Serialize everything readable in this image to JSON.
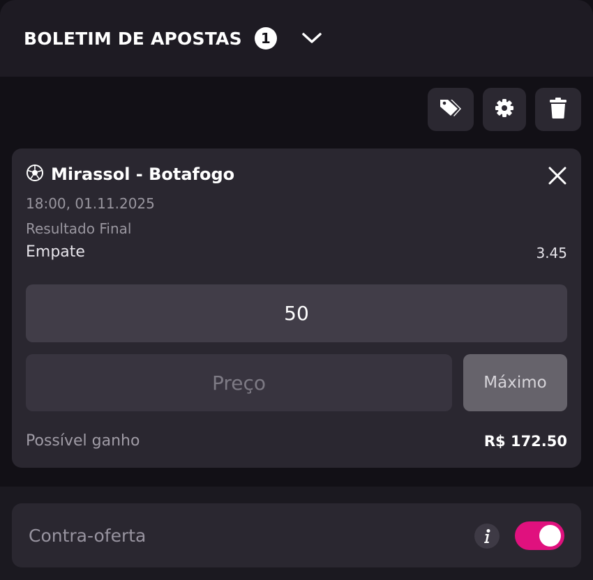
{
  "header": {
    "title": "BOLETIM DE APOSTAS",
    "count": "1",
    "chevron_icon": "chevron-down-icon"
  },
  "toolbar": {
    "tags_icon": "tags-icon",
    "settings_icon": "gear-icon",
    "trash_icon": "trash-icon"
  },
  "bet": {
    "sport_icon": "soccer-ball-icon",
    "match": "Mirassol - Botafogo",
    "datetime": "18:00, 01.11.2025",
    "market": "Resultado Final",
    "selection": "Empate",
    "odds": "3.45",
    "stake": "50",
    "price_placeholder": "Preço",
    "max_label": "Máximo",
    "gain_label": "Possível ganho",
    "gain_value": "R$ 172.50"
  },
  "counter_offer": {
    "label": "Contra-oferta",
    "enabled": true
  },
  "colors": {
    "accent": "#e0117e",
    "background": "#121016",
    "card": "#2a2730"
  }
}
